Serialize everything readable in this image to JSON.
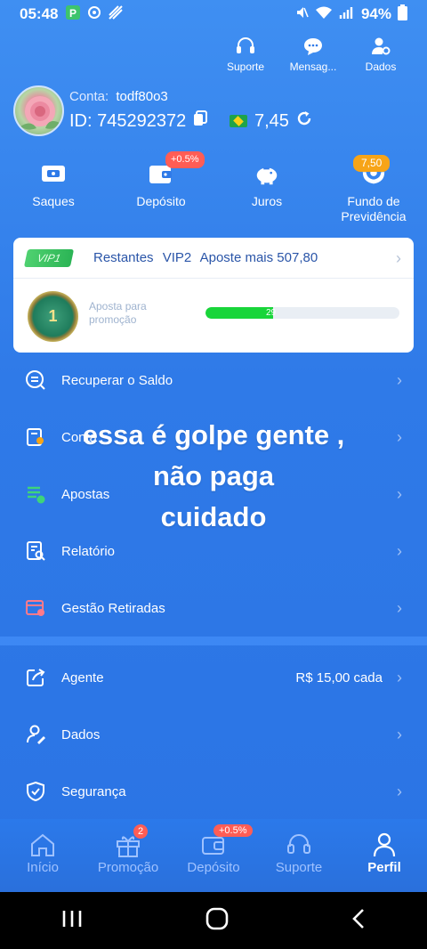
{
  "status_bar": {
    "time": "05:48",
    "battery": "94%"
  },
  "top_actions": [
    {
      "label": "Suporte",
      "icon": "headset-icon"
    },
    {
      "label": "Mensag...",
      "icon": "message-icon"
    },
    {
      "label": "Dados",
      "icon": "user-settings-icon"
    }
  ],
  "profile": {
    "account_label": "Conta:",
    "account_value": "todf80o3",
    "id_text": "ID: 745292372",
    "balance": "7,45"
  },
  "quick_actions": [
    {
      "label": "Saques",
      "icon": "withdraw-icon"
    },
    {
      "label": "Depósito",
      "icon": "wallet-icon",
      "badge": "+0.5%"
    },
    {
      "label": "Juros",
      "icon": "piggy-bank-icon"
    },
    {
      "label": "Fundo de Previdência",
      "icon": "hands-icon",
      "badge": "7,50"
    }
  ],
  "vip": {
    "tag": "VIP1",
    "remaining": "Restantes",
    "level": "VIP2",
    "bet_more": "Aposte mais 507,80",
    "medal_level": "1",
    "promo_label": "Aposta para promoção",
    "progress_text": "29",
    "progress_fraction": 0.35
  },
  "menu": [
    {
      "label": "Recuperar o Saldo",
      "icon": "recover-icon"
    },
    {
      "label": "Conta",
      "icon": "account-icon"
    },
    {
      "label": "Apostas",
      "icon": "bets-icon"
    },
    {
      "label": "Relatório",
      "icon": "report-icon"
    },
    {
      "label": "Gestão Retiradas",
      "icon": "withdraw-manage-icon"
    },
    {
      "label": "Agente",
      "icon": "share-icon",
      "value": "R$ 15,00 cada"
    },
    {
      "label": "Dados",
      "icon": "user-edit-icon"
    },
    {
      "label": "Segurança",
      "icon": "shield-icon"
    }
  ],
  "caption": {
    "line1": "essa é golpe gente ,",
    "line2": "não paga",
    "line3": "cuidado"
  },
  "bottom_nav": [
    {
      "label": "Início",
      "icon": "home-icon"
    },
    {
      "label": "Promoção",
      "icon": "gift-icon",
      "badge": "2"
    },
    {
      "label": "Depósito",
      "icon": "wallet-icon",
      "badge": "+0.5%"
    },
    {
      "label": "Suporte",
      "icon": "headset-icon"
    },
    {
      "label": "Perfil",
      "icon": "person-icon",
      "active": true
    }
  ],
  "colors": {
    "background": "#2f7ae8",
    "progress": "#19d53a",
    "badge_red": "#ff5d55",
    "badge_gold": "#f7a417"
  }
}
